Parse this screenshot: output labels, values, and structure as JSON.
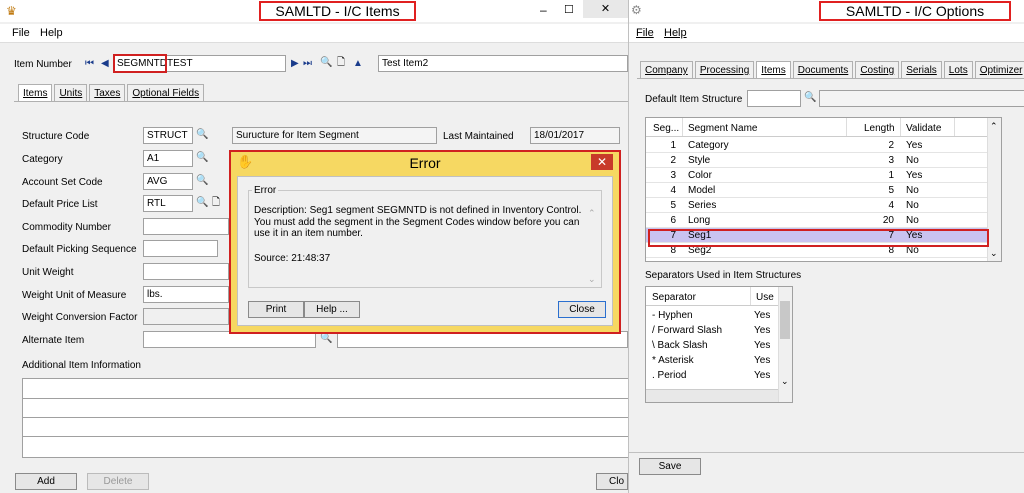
{
  "left_window": {
    "title": "SAMLTD - I/C Items",
    "menu": [
      "File",
      "Help"
    ],
    "item_number_label": "Item Number",
    "item_number_value": "SEGMNTDTEST",
    "item_desc_value": "Test Item2",
    "tabs": [
      "Items",
      "Units",
      "Taxes",
      "Optional Fields"
    ],
    "fields": {
      "structure_code_label": "Structure Code",
      "structure_code_value": "STRUCT",
      "structure_desc": "Suructure for Item Segment",
      "last_maintained_label": "Last Maintained",
      "last_maintained_value": "18/01/2017",
      "category_label": "Category",
      "category_value": "A1",
      "account_set_label": "Account Set Code",
      "account_set_value": "AVG",
      "price_list_label": "Default Price List",
      "price_list_value": "RTL",
      "commodity_label": "Commodity Number",
      "picking_label": "Default Picking Sequence",
      "unit_weight_label": "Unit Weight",
      "weight_uom_label": "Weight Unit of Measure",
      "weight_uom_value": "lbs.",
      "weight_conv_label": "Weight Conversion Factor",
      "alternate_label": "Alternate Item",
      "additional_label": "Additional Item Information"
    },
    "add_label": "Add",
    "delete_label": "Delete",
    "close_label": "Clo"
  },
  "error_dialog": {
    "title": "Error",
    "close_x": "✕",
    "group_label": "Error",
    "description": "Description: Seg1 segment SEGMNTD is not defined in Inventory Control. You must add the segment in the Segment Codes window before you can use it in an item number.",
    "source": "Source:  21:48:37",
    "print_label": "Print",
    "help_label": "Help ...",
    "close_label": "Close"
  },
  "right_window": {
    "title": "SAMLTD - I/C Options",
    "menu": [
      "File",
      "Help"
    ],
    "tabs": [
      "Company",
      "Processing",
      "Items",
      "Documents",
      "Costing",
      "Serials",
      "Lots",
      "Optimizer"
    ],
    "default_structure_label": "Default Item Structure",
    "segments": {
      "headers": [
        "Seg...",
        "Segment Name",
        "Length",
        "Validate"
      ],
      "rows": [
        [
          "1",
          "Category",
          "2",
          "Yes"
        ],
        [
          "2",
          "Style",
          "3",
          "No"
        ],
        [
          "3",
          "Color",
          "1",
          "Yes"
        ],
        [
          "4",
          "Model",
          "5",
          "No"
        ],
        [
          "5",
          "Series",
          "4",
          "No"
        ],
        [
          "6",
          "Long",
          "20",
          "No"
        ],
        [
          "7",
          "Seg1",
          "7",
          "Yes"
        ],
        [
          "8",
          "Seg2",
          "8",
          "No"
        ]
      ]
    },
    "separators_label": "Separators Used in Item Structures",
    "separators": {
      "headers": [
        "Separator",
        "Use"
      ],
      "rows": [
        [
          "-  Hyphen",
          "Yes"
        ],
        [
          "/  Forward Slash",
          "Yes"
        ],
        [
          "\\  Back Slash",
          "Yes"
        ],
        [
          "*  Asterisk",
          "Yes"
        ],
        [
          ".  Period",
          "Yes"
        ]
      ]
    },
    "save_label": "Save"
  },
  "colors": {
    "highlight_row": "#c9c3f0",
    "dialog_bg": "#f6d862",
    "annotation_red": "#d02020"
  }
}
